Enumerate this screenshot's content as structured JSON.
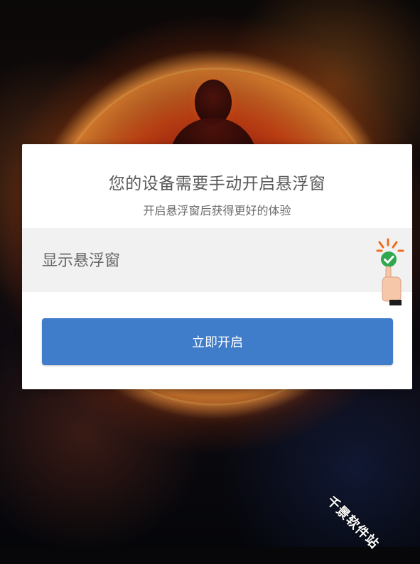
{
  "dialog": {
    "title": "您的设备需要手动开启悬浮窗",
    "subtitle": "开启悬浮窗后获得更好的体验",
    "setting": {
      "label": "显示悬浮窗"
    },
    "primary_button_label": "立即开启"
  },
  "watermark": {
    "text": "千景软件站"
  },
  "colors": {
    "primary": "#3f7cc9",
    "setting_row_bg": "#f1f1f1",
    "check_green": "#2fa84f",
    "hint_orange": "#f26b1d"
  },
  "icons": {
    "toggle_hint": "check-with-pointing-hand-icon"
  }
}
